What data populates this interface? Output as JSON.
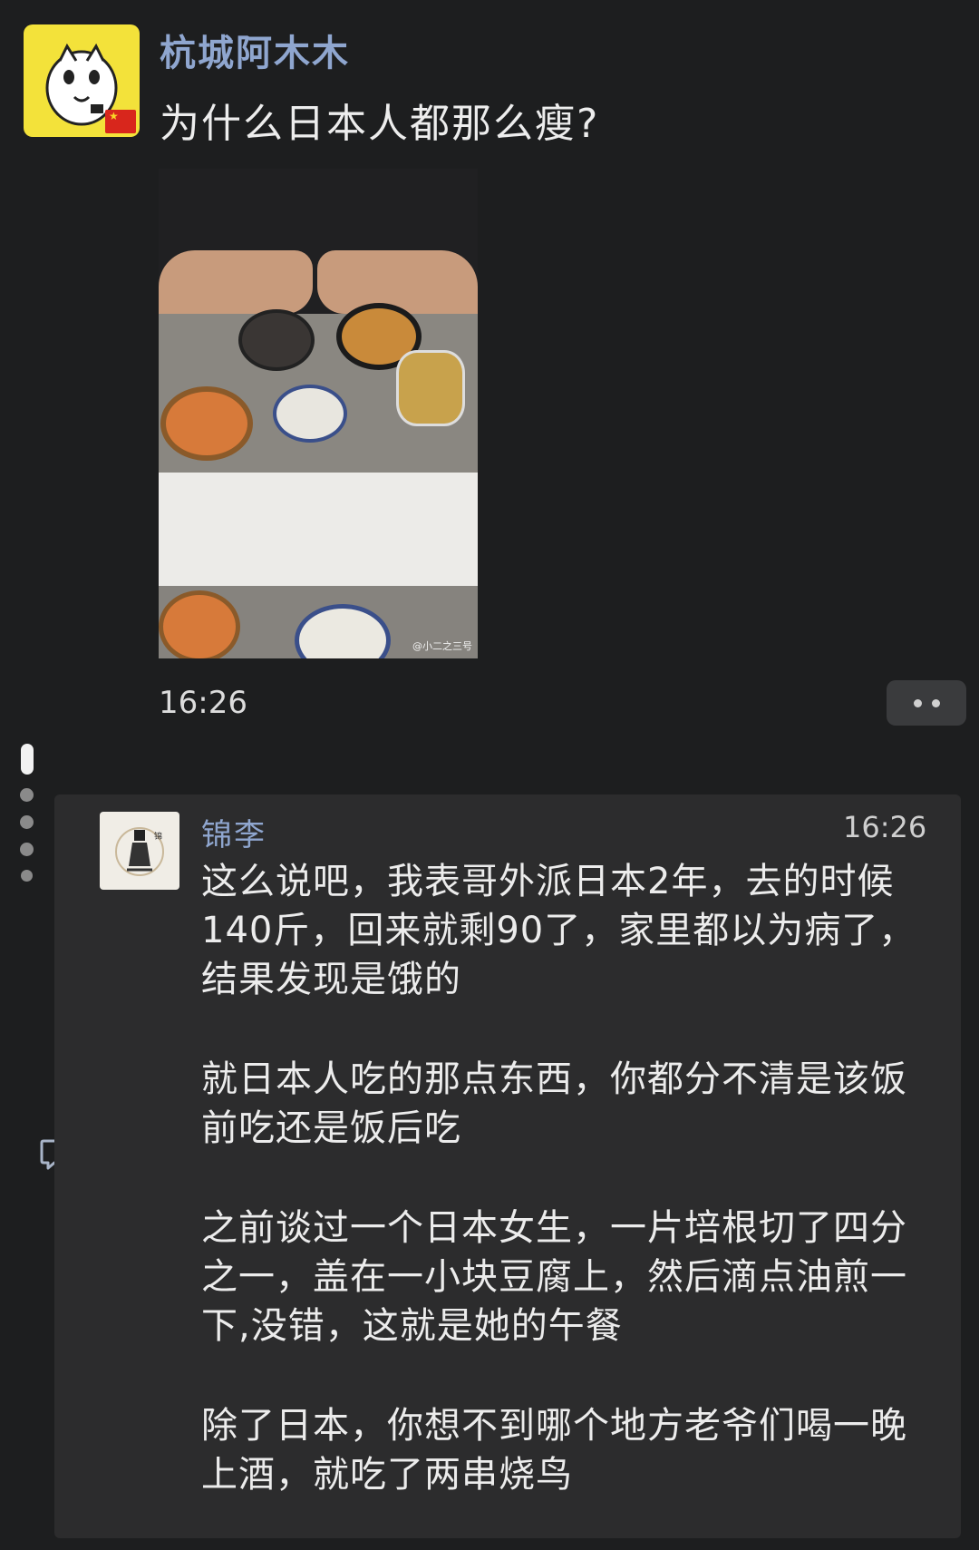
{
  "post": {
    "author": "杭城阿木木",
    "text": "为什么日本人都那么瘦?",
    "time": "16:26",
    "photo_watermark": "@小二之三号"
  },
  "reply": {
    "name": "锦李",
    "time": "16:26",
    "paragraphs": [
      "这么说吧，我表哥外派日本2年，去的时候140斤，回来就剩90了，家里都以为病了，结果发现是饿的",
      "就日本人吃的那点东西，你都分不清是该饭前吃还是饭后吃",
      "之前谈过一个日本女生，一片培根切了四分之一，盖在一小块豆腐上，然后滴点油煎一下,没错，这就是她的午餐",
      "除了日本，你想不到哪个地方老爷们喝一晚上酒，就吃了两串烧鸟"
    ]
  },
  "icons": {
    "more": "more-dots-icon",
    "comment": "comment-icon",
    "flag": "china-flag-icon"
  },
  "colors": {
    "background": "#1d1e1f",
    "card": "#2c2c2d",
    "name_link": "#8fa6cf"
  }
}
